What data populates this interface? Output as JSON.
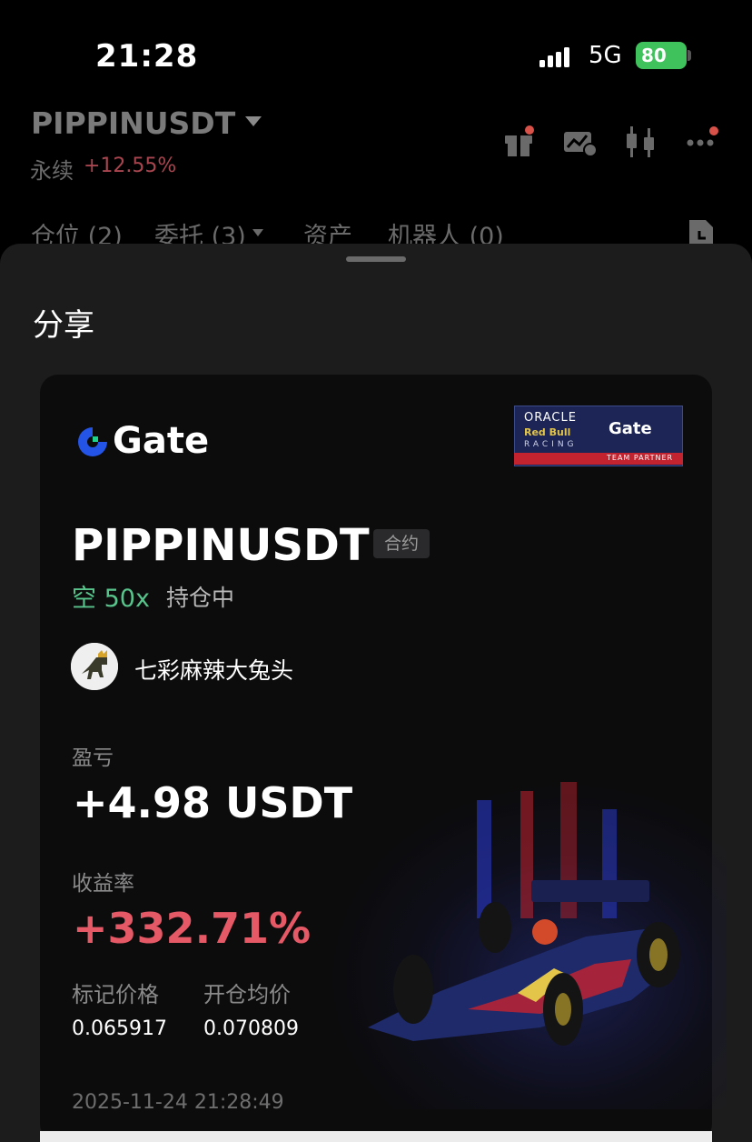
{
  "status_bar": {
    "time": "21:28",
    "network": "5G",
    "battery": "80"
  },
  "header": {
    "symbol": "PIPPINUSDT",
    "contract_type": "永续",
    "change": "+12.55%",
    "icons": [
      "gift-icon",
      "chart-settings-icon",
      "candlestick-icon",
      "more-icon"
    ]
  },
  "tabs": [
    {
      "label": "仓位 (2)"
    },
    {
      "label": "委托 (3)"
    },
    {
      "label": "资产"
    },
    {
      "label": "机器人 (0)"
    }
  ],
  "sheet": {
    "title": "分享"
  },
  "card": {
    "brand": "Gate",
    "partner_badge": {
      "line1": "ORACLE",
      "line2": "Red Bull",
      "line3": "RACING",
      "brand": "Gate",
      "footer": "TEAM PARTNER"
    },
    "pair": "PIPPINUSDT",
    "tag": "合约",
    "direction": "空 50x",
    "status": "持仓中",
    "username": "七彩麻辣大兔头",
    "pnl_label": "盈亏",
    "pnl_value": "+4.98 USDT",
    "roi_label": "收益率",
    "roi_value": "+332.71%",
    "mark_price_label": "标记价格",
    "mark_price": "0.065917",
    "entry_price_label": "开仓均价",
    "entry_price": "0.070809",
    "timestamp": "2025-11-24 21:28:49"
  },
  "colors": {
    "background": "#000000",
    "sheet": "#1c1c1c",
    "card": "#0c0c0d",
    "profit_red": "#e55967",
    "short_green": "#58c48b",
    "brand_blue": "#2354e6",
    "brand_green": "#1fd28d"
  }
}
